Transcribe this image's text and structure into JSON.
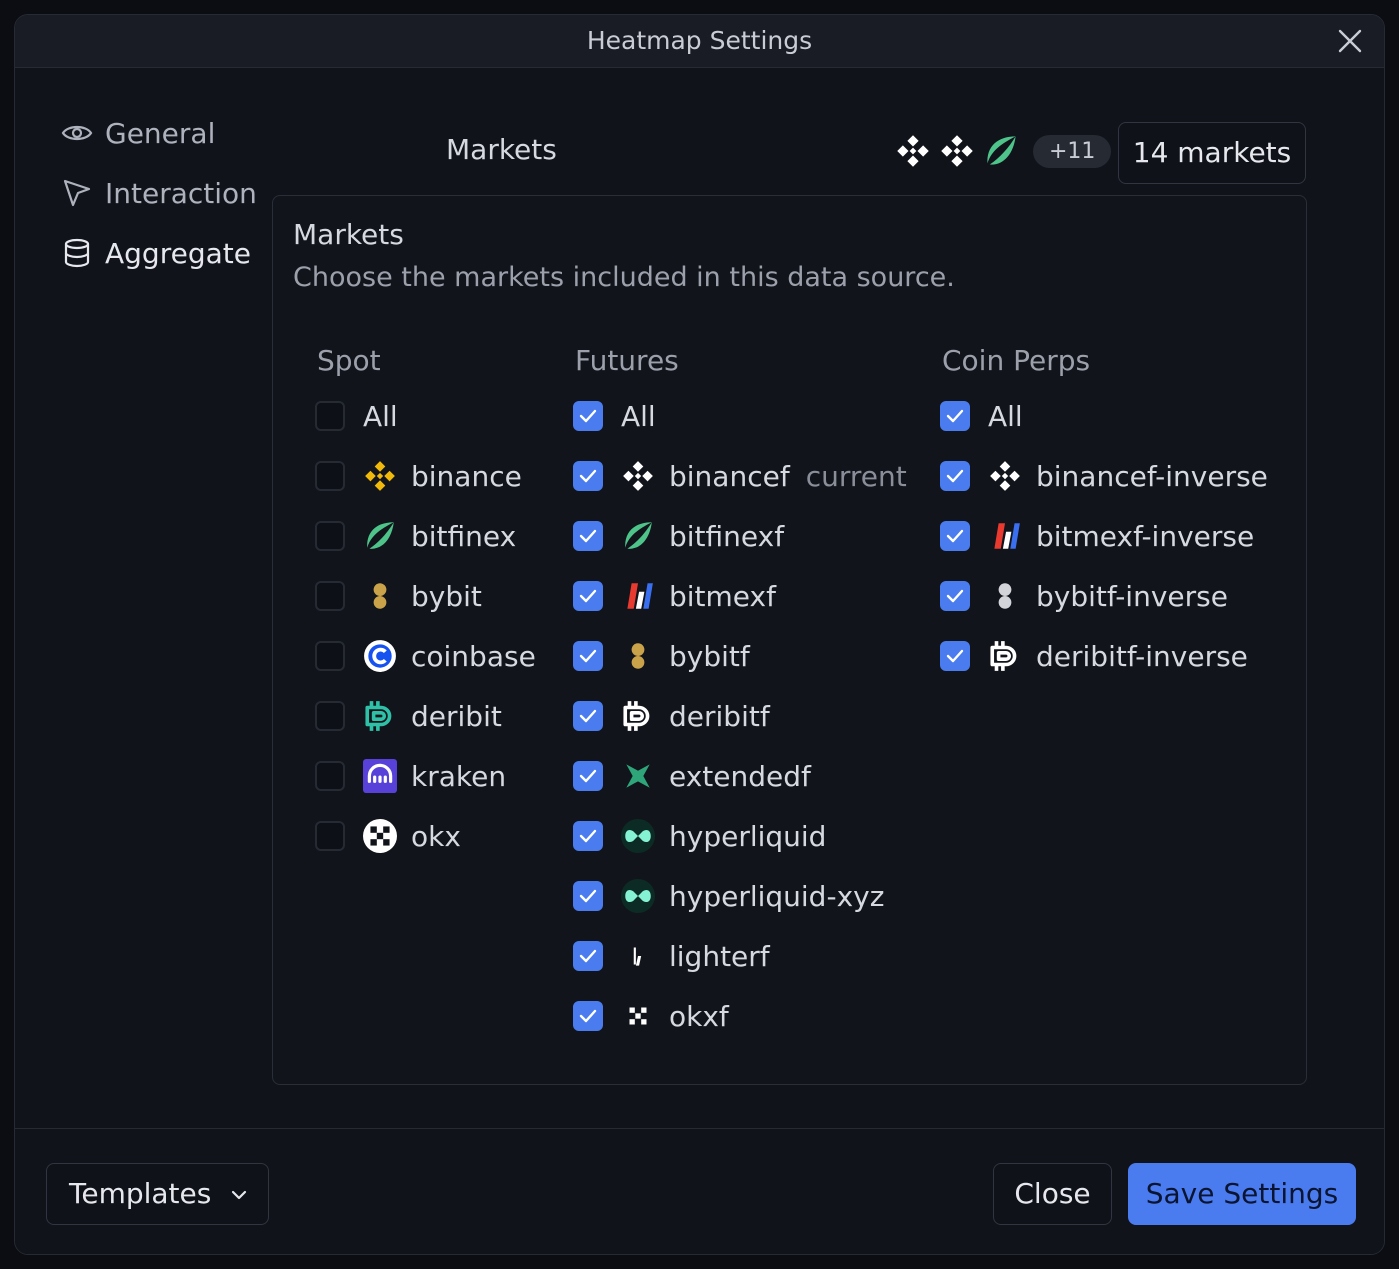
{
  "window": {
    "title": "Heatmap Settings"
  },
  "nav": [
    {
      "label": "General",
      "icon": "eye-icon"
    },
    {
      "label": "Interaction",
      "icon": "cursor-icon"
    },
    {
      "label": "Aggregate",
      "icon": "database-icon",
      "active": true
    }
  ],
  "header": {
    "label": "Markets",
    "more_count": "+11",
    "markets_button": "14 markets"
  },
  "panel": {
    "title": "Markets",
    "description": "Choose the markets included in this data source."
  },
  "columns": {
    "spot": {
      "heading": "Spot",
      "all_label": "All",
      "items": [
        {
          "label": "binance",
          "checked": false,
          "icon": "binance-icon"
        },
        {
          "label": "bitfinex",
          "checked": false,
          "icon": "bitfinex-icon"
        },
        {
          "label": "bybit",
          "checked": false,
          "icon": "bybit-icon"
        },
        {
          "label": "coinbase",
          "checked": false,
          "icon": "coinbase-icon"
        },
        {
          "label": "deribit",
          "checked": false,
          "icon": "deribit-icon"
        },
        {
          "label": "kraken",
          "checked": false,
          "icon": "kraken-icon"
        },
        {
          "label": "okx",
          "checked": false,
          "icon": "okx-icon"
        }
      ]
    },
    "futures": {
      "heading": "Futures",
      "all_label": "All",
      "items": [
        {
          "label": "binancef",
          "checked": true,
          "icon": "binance-icon",
          "tag": "current"
        },
        {
          "label": "bitfinexf",
          "checked": true,
          "icon": "bitfinex-icon"
        },
        {
          "label": "bitmexf",
          "checked": true,
          "icon": "bitmex-icon"
        },
        {
          "label": "bybitf",
          "checked": true,
          "icon": "bybit-icon"
        },
        {
          "label": "deribitf",
          "checked": true,
          "icon": "deribit-icon"
        },
        {
          "label": "extendedf",
          "checked": true,
          "icon": "extended-icon"
        },
        {
          "label": "hyperliquid",
          "checked": true,
          "icon": "hyperliquid-icon"
        },
        {
          "label": "hyperliquid-xyz",
          "checked": true,
          "icon": "hyperliquid-icon"
        },
        {
          "label": "lighterf",
          "checked": true,
          "icon": "lighter-icon"
        },
        {
          "label": "okxf",
          "checked": true,
          "icon": "okx-icon"
        }
      ]
    },
    "coin_perps": {
      "heading": "Coin Perps",
      "all_label": "All",
      "items": [
        {
          "label": "binancef-inverse",
          "checked": true,
          "icon": "binance-icon"
        },
        {
          "label": "bitmexf-inverse",
          "checked": true,
          "icon": "bitmex-icon"
        },
        {
          "label": "bybitf-inverse",
          "checked": true,
          "icon": "bybit-icon"
        },
        {
          "label": "deribitf-inverse",
          "checked": true,
          "icon": "deribit-icon"
        }
      ]
    }
  },
  "footer": {
    "templates_label": "Templates",
    "close_label": "Close",
    "save_label": "Save Settings"
  },
  "colors": {
    "accent": "#4a7cf0",
    "background": "#10131a"
  }
}
